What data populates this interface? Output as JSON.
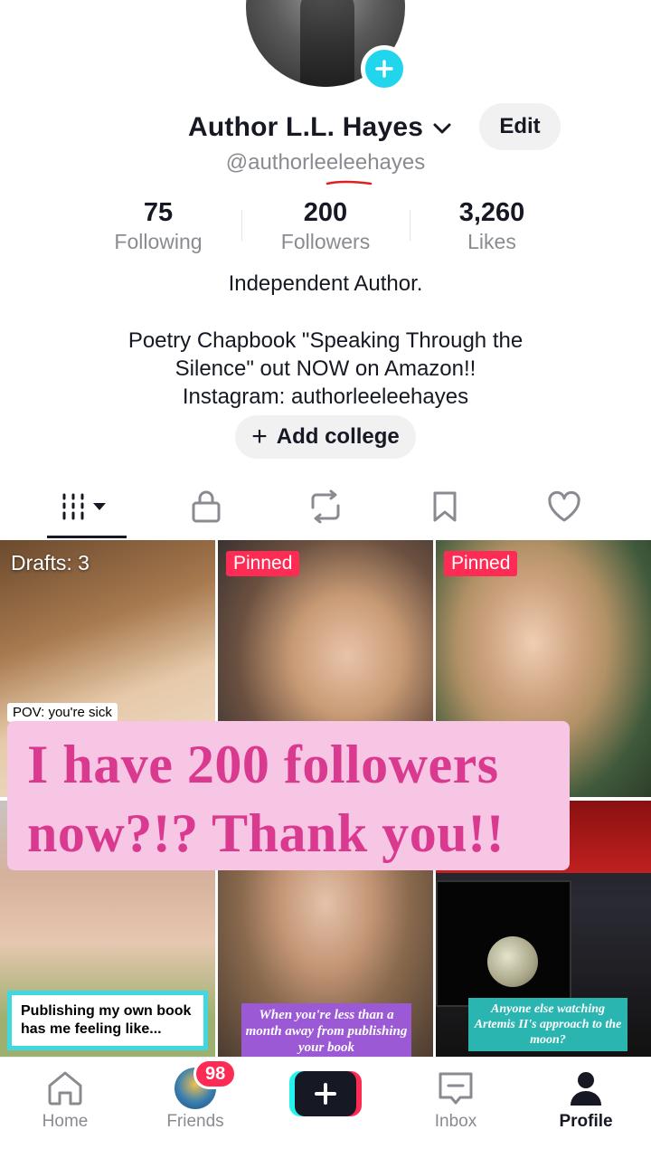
{
  "profile": {
    "display_name": "Author L.L. Hayes",
    "handle": "@authorleeleehayes",
    "edit_label": "Edit"
  },
  "stats": [
    {
      "value": "75",
      "label": "Following"
    },
    {
      "value": "200",
      "label": "Followers"
    },
    {
      "value": "3,260",
      "label": "Likes"
    }
  ],
  "bio": {
    "line1": "Independent Author.",
    "line2": "Poetry Chapbook \"Speaking Through the",
    "line3": "Silence\" out NOW on Amazon!!",
    "line4": "Instagram: authorleeleehayes"
  },
  "college_button": "Add college",
  "tabs": [
    "grid-icon",
    "lock-icon",
    "repost-icon",
    "bookmark-icon",
    "heart-icon"
  ],
  "grid": {
    "drafts_label": "Drafts: 3",
    "pinned_label": "Pinned",
    "pov_caption": "POV: you're sick",
    "caption_book": "Publishing my own book has me feeling like...",
    "caption_month": "When you're less than a month away from publishing your book",
    "caption_moon": "Anyone else watching Artemis II's approach to the moon?"
  },
  "overlay": {
    "line1": "I have 200 followers",
    "line2": "now?!? Thank you!!"
  },
  "nav": {
    "home": "Home",
    "friends": "Friends",
    "friends_badge": "98",
    "inbox": "Inbox",
    "profile": "Profile"
  },
  "colors": {
    "accent_red": "#fe2c55",
    "accent_cyan": "#25f4ee",
    "overlay_bg": "#f7c6e4",
    "overlay_text": "#d93a8f"
  }
}
